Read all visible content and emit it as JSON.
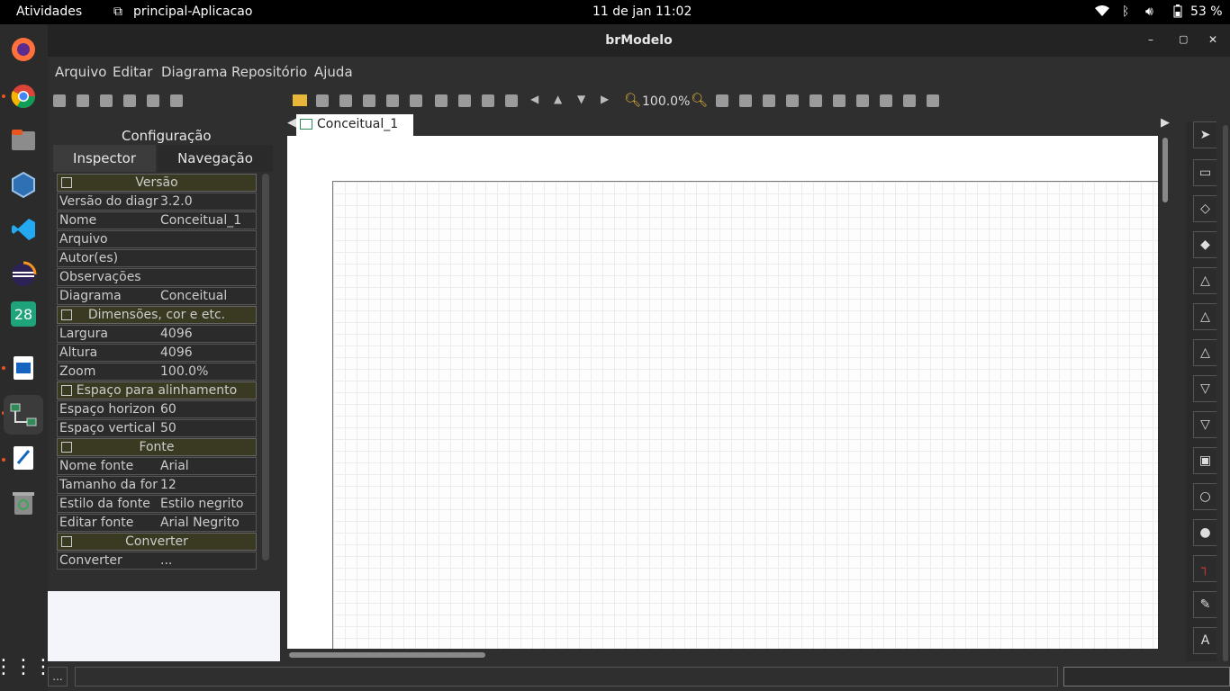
{
  "topbar": {
    "activities": "Atividades",
    "app_name": "principal-Aplicacao",
    "clock": "11 de jan  11:02",
    "battery": "53 %"
  },
  "dock": {
    "calendar_day": "28"
  },
  "window": {
    "title": "brModelo",
    "min_glyph": "–",
    "max_glyph": "▢",
    "close_glyph": "✕"
  },
  "menu": {
    "items": [
      "Arquivo",
      "Editar",
      "Diagrama",
      "Repositório",
      "Ajuda"
    ]
  },
  "left_panel": {
    "title": "Configuração",
    "tabs": [
      "Inspector",
      "Navegação"
    ],
    "sections": [
      {
        "title": "Versão",
        "rows": [
          [
            "Versão do diagr",
            "3.2.0"
          ],
          [
            "Nome",
            "Conceitual_1"
          ],
          [
            "Arquivo",
            ""
          ],
          [
            "Autor(es)",
            ""
          ],
          [
            "Observações",
            ""
          ],
          [
            "Diagrama",
            "Conceitual"
          ]
        ]
      },
      {
        "title": "Dimensões, cor e etc.",
        "rows": [
          [
            "Largura",
            "4096"
          ],
          [
            "Altura",
            "4096"
          ],
          [
            "Zoom",
            "100.0%"
          ]
        ]
      },
      {
        "title": "Espaço para alinhamento",
        "rows": [
          [
            "Espaço horizon",
            "60"
          ],
          [
            "Espaço vertical",
            "50"
          ]
        ]
      },
      {
        "title": "Fonte",
        "rows": [
          [
            "Nome fonte",
            "Arial"
          ],
          [
            "Tamanho da for",
            "12"
          ],
          [
            "Estilo da fonte",
            "Estilo negrito"
          ],
          [
            "Editar fonte",
            "Arial Negrito"
          ]
        ]
      },
      {
        "title": "Converter",
        "rows": [
          [
            "Converter",
            "..."
          ]
        ]
      }
    ]
  },
  "toolbar": {
    "zoom": "100.0%"
  },
  "doc_tab": {
    "label": "Conceitual_1"
  },
  "status": {
    "left": "..."
  }
}
